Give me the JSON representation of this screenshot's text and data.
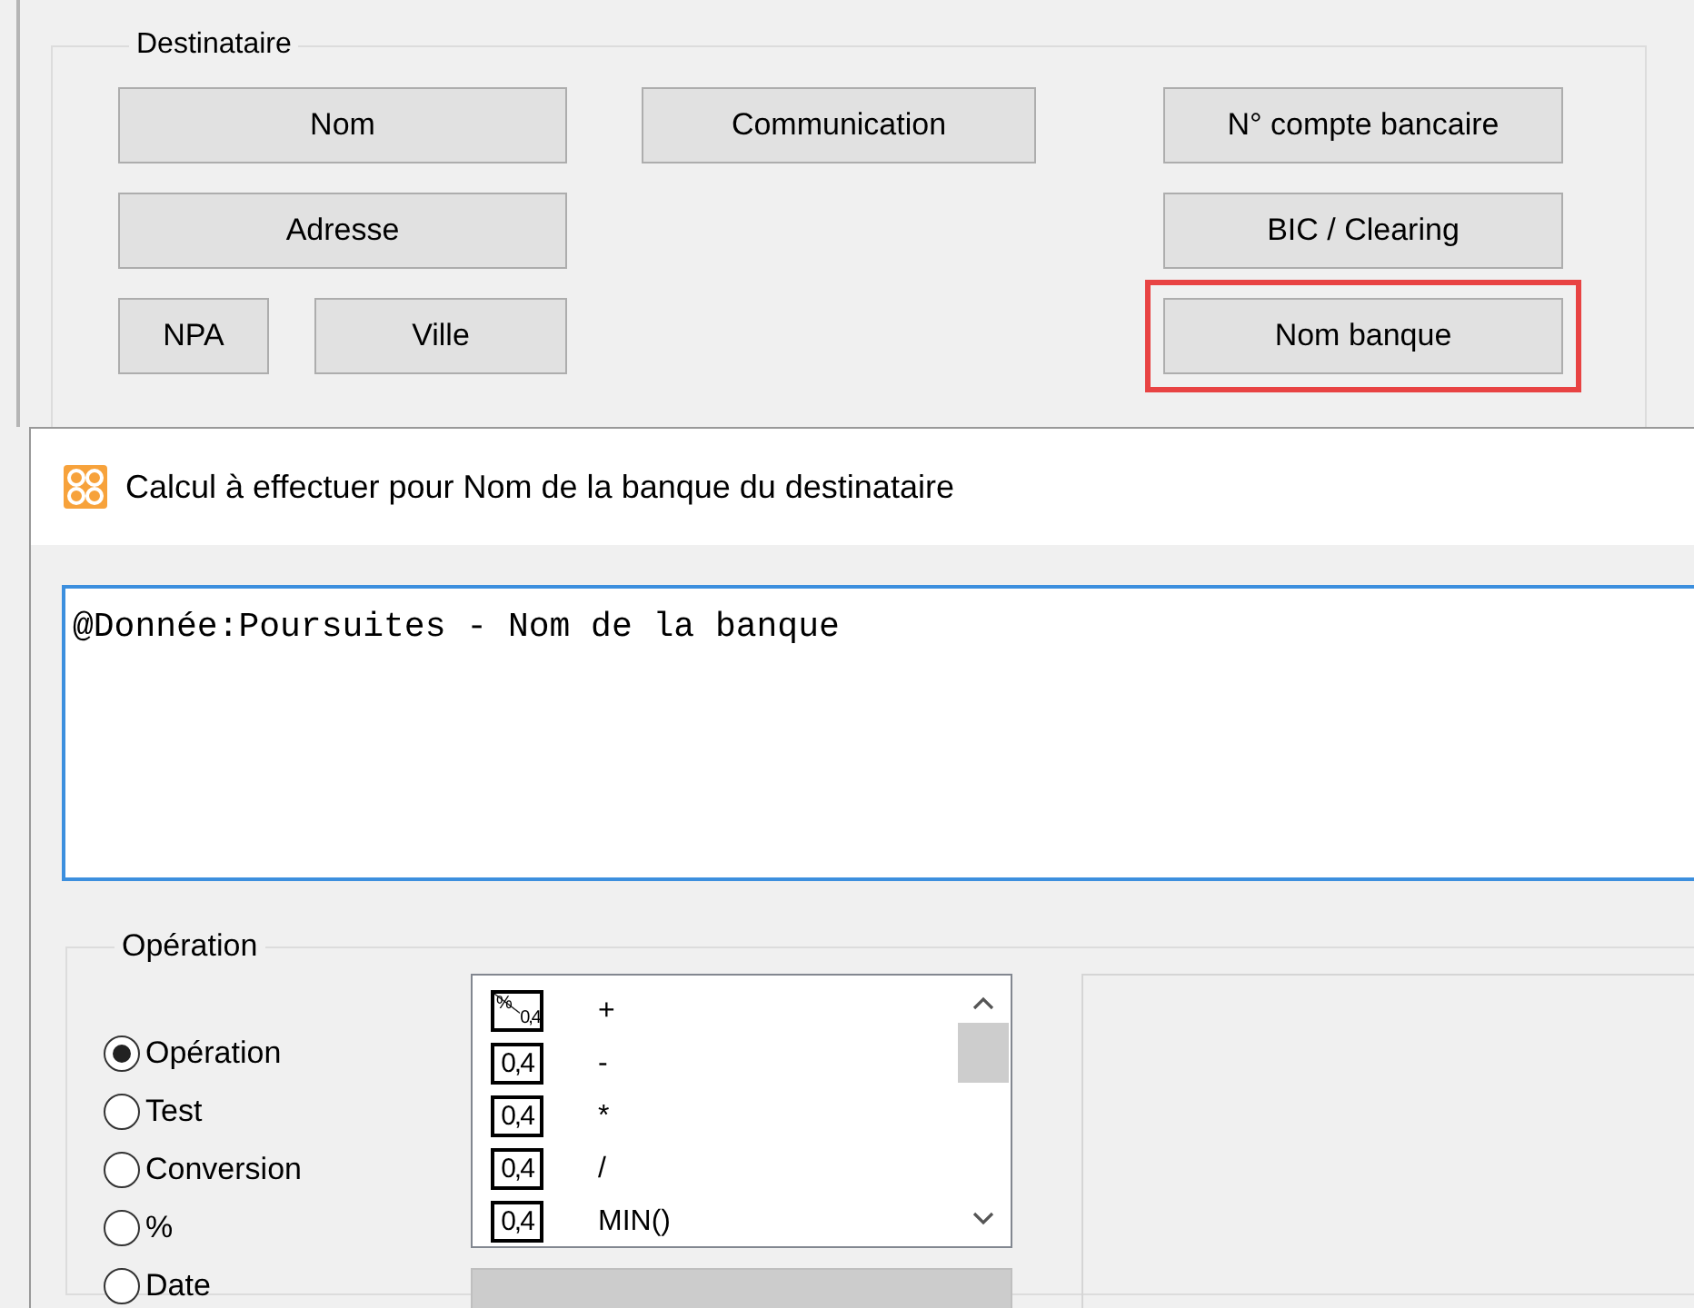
{
  "background_window": {
    "group": "Destinataire",
    "rows": [
      {
        "left": [
          {
            "label": "Nom",
            "highlighted": false
          }
        ],
        "middle": [
          {
            "label": "Communication",
            "highlighted": false
          }
        ],
        "right": [
          {
            "label": "N° compte bancaire",
            "highlighted": false
          }
        ]
      },
      {
        "left": [
          {
            "label": "Adresse",
            "highlighted": false
          }
        ],
        "middle": [],
        "right": [
          {
            "label": "BIC / Clearing",
            "highlighted": false
          }
        ]
      },
      {
        "left": [
          {
            "label": "NPA",
            "highlighted": false
          },
          {
            "label": "Ville",
            "highlighted": false
          }
        ],
        "middle": [],
        "right": [
          {
            "label": "Nom banque",
            "highlighted": true
          }
        ]
      }
    ]
  },
  "dialog": {
    "title": "Calcul à effectuer pour Nom de la banque du destinataire",
    "formula": "@Donnée:Poursuites - Nom de la banque",
    "operation_group": {
      "legend": "Opération",
      "modes": [
        {
          "label": "Opération",
          "selected": true
        },
        {
          "label": "Test",
          "selected": false
        },
        {
          "label": "Conversion",
          "selected": false
        },
        {
          "label": "%",
          "selected": false
        },
        {
          "label": "Date",
          "selected": false
        }
      ],
      "list": [
        {
          "kind": "percent",
          "icon_text": [
            "%",
            "0,4"
          ],
          "label": "+"
        },
        {
          "kind": "number",
          "icon_text": [
            "0,4"
          ],
          "label": "-"
        },
        {
          "kind": "number",
          "icon_text": [
            "0,4"
          ],
          "label": "*"
        },
        {
          "kind": "number",
          "icon_text": [
            "0,4"
          ],
          "label": "/"
        },
        {
          "kind": "number",
          "icon_text": [
            "0,4"
          ],
          "label": "MIN()"
        }
      ]
    }
  }
}
